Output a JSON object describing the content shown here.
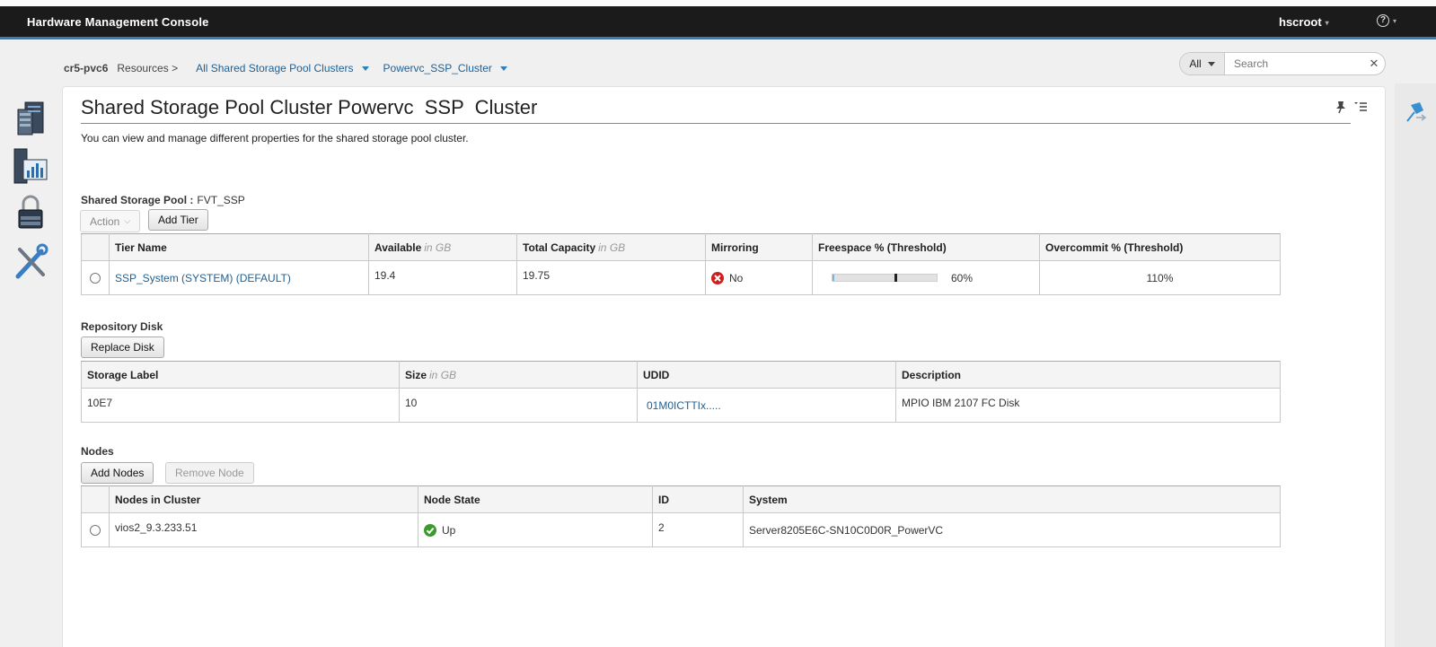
{
  "app": {
    "title": "Hardware Management Console",
    "user": "hscroot",
    "help_label": "?"
  },
  "breadcrumb": {
    "system": "cr5-pvc6",
    "resources": "Resources >",
    "links": [
      "All Shared Storage Pool Clusters",
      "Powervc_SSP_Cluster"
    ]
  },
  "search": {
    "scope": "All",
    "placeholder": "Search",
    "clear": "✕"
  },
  "leftnav": [
    {
      "name": "servers",
      "icon": "server-icon"
    },
    {
      "name": "performance",
      "icon": "performance-monitor-icon"
    },
    {
      "name": "security",
      "icon": "lock-icon"
    },
    {
      "name": "settings",
      "icon": "tools-icon"
    }
  ],
  "page": {
    "title": "Shared Storage Pool Cluster Powervc  SSP  Cluster",
    "description": "You can view and manage different properties for the shared storage pool cluster."
  },
  "ssp": {
    "label": "Shared Storage Pool :",
    "value": "FVT_SSP",
    "action_label": "Action",
    "add_tier_label": "Add Tier",
    "columns": {
      "tier_name": "Tier Name",
      "available": "Available",
      "available_unit": "in GB",
      "total": "Total Capacity",
      "total_unit": "in GB",
      "mirroring": "Mirroring",
      "freespace": "Freespace % (Threshold)",
      "overcommit": "Overcommit % (Threshold)"
    },
    "rows": [
      {
        "tier_name": "SSP_System (SYSTEM) (DEFAULT)",
        "available": "19.4",
        "total": "19.75",
        "mirroring": "No",
        "freespace_fill": 0.02,
        "freespace_threshold": 0.6,
        "freespace": "60%",
        "overcommit": "110%"
      }
    ]
  },
  "repository": {
    "label": "Repository Disk",
    "replace_label": "Replace Disk",
    "columns": {
      "storage_label": "Storage Label",
      "size": "Size",
      "size_unit": "in GB",
      "udid": "UDID",
      "description": "Description"
    },
    "rows": [
      {
        "storage_label": "10E7",
        "size": "10",
        "udid": "01M0ICTTIx.....",
        "description": "MPIO IBM 2107 FC Disk"
      }
    ]
  },
  "nodes": {
    "label": "Nodes",
    "add_label": "Add Nodes",
    "remove_label": "Remove Node",
    "columns": {
      "name": "Nodes in Cluster",
      "state": "Node State",
      "id": "ID",
      "system": "System"
    },
    "rows": [
      {
        "name": "vios2_9.3.233.51",
        "state": "Up",
        "id": "2",
        "system": "Server8205E6C-SN10C0D0R_PowerVC"
      }
    ]
  },
  "colors": {
    "accent": "#2f7fb8",
    "link": "#1f5f93",
    "error": "#cc1f1f",
    "ok": "#3a9a2e"
  }
}
